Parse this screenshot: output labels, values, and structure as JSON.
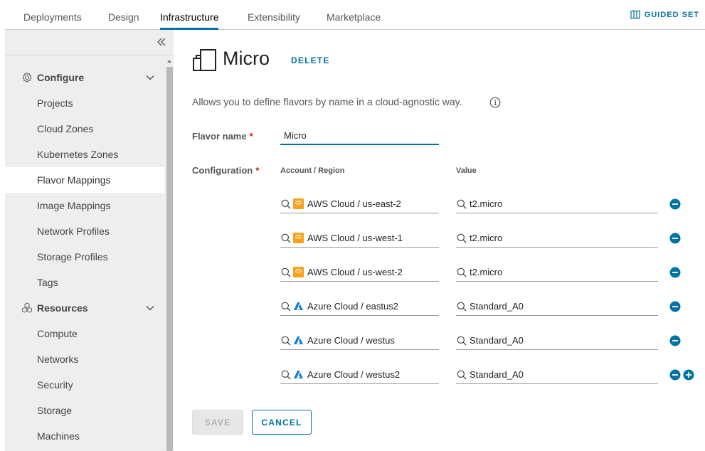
{
  "topnav": {
    "tabs": [
      {
        "label": "Deployments"
      },
      {
        "label": "Design"
      },
      {
        "label": "Infrastructure",
        "active": true
      },
      {
        "label": "Extensibility"
      },
      {
        "label": "Marketplace"
      }
    ],
    "guided_setup": "GUIDED SET"
  },
  "sidebar": {
    "groups": [
      {
        "label": "Configure",
        "icon": "gear-icon",
        "expanded": true,
        "items": [
          {
            "label": "Projects"
          },
          {
            "label": "Cloud Zones"
          },
          {
            "label": "Kubernetes Zones"
          },
          {
            "label": "Flavor Mappings",
            "active": true
          },
          {
            "label": "Image Mappings"
          },
          {
            "label": "Network Profiles"
          },
          {
            "label": "Storage Profiles"
          },
          {
            "label": "Tags"
          }
        ]
      },
      {
        "label": "Resources",
        "icon": "cubes-icon",
        "expanded": true,
        "items": [
          {
            "label": "Compute"
          },
          {
            "label": "Networks"
          },
          {
            "label": "Security"
          },
          {
            "label": "Storage"
          },
          {
            "label": "Machines"
          }
        ]
      }
    ]
  },
  "main": {
    "title": "Micro",
    "delete_label": "DELETE",
    "description": "Allows you to define flavors by name in a cloud-agnostic way.",
    "flavor_name_label": "Flavor name",
    "flavor_name_value": "Micro",
    "configuration_label": "Configuration",
    "required_mark": "*",
    "col_account": "Account / Region",
    "col_value": "Value",
    "rows": [
      {
        "account": "AWS Cloud / us-east-2",
        "provider": "aws",
        "value": "t2.micro"
      },
      {
        "account": "AWS Cloud / us-west-1",
        "provider": "aws",
        "value": "t2.micro"
      },
      {
        "account": "AWS Cloud / us-west-2",
        "provider": "aws",
        "value": "t2.micro"
      },
      {
        "account": "Azure Cloud / eastus2",
        "provider": "azure",
        "value": "Standard_A0"
      },
      {
        "account": "Azure Cloud / westus",
        "provider": "azure",
        "value": "Standard_A0"
      },
      {
        "account": "Azure Cloud / westus2",
        "provider": "azure",
        "value": "Standard_A0"
      }
    ],
    "save_label": "SAVE",
    "cancel_label": "CANCEL"
  },
  "colors": {
    "accent": "#0072a3",
    "required": "#c92100",
    "aws": "#f7a21c",
    "azure": "#0a7ad6"
  }
}
